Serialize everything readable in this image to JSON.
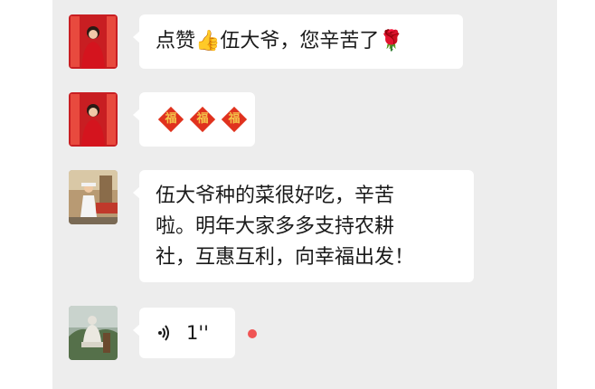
{
  "messages": [
    {
      "type": "text",
      "text": "点赞👍伍大爷，您辛苦了🌹",
      "avatar": "red-figure-avatar"
    },
    {
      "type": "sticker",
      "stickers": [
        "福",
        "福",
        "福"
      ],
      "avatar": "red-figure-avatar"
    },
    {
      "type": "text",
      "text": "伍大爷种的菜很好吃，辛苦\n啦。明年大家多多支持农耕\n社，互惠互利，向幸福出发！",
      "avatar": "street-photo-avatar"
    },
    {
      "type": "voice",
      "duration": "1''",
      "unread": true,
      "avatar": "statue-photo-avatar"
    }
  ],
  "colors": {
    "chat_background": "#ededed",
    "bubble": "#ffffff",
    "unread_dot": "#f05454",
    "fu_diamond": "#e0321e"
  }
}
